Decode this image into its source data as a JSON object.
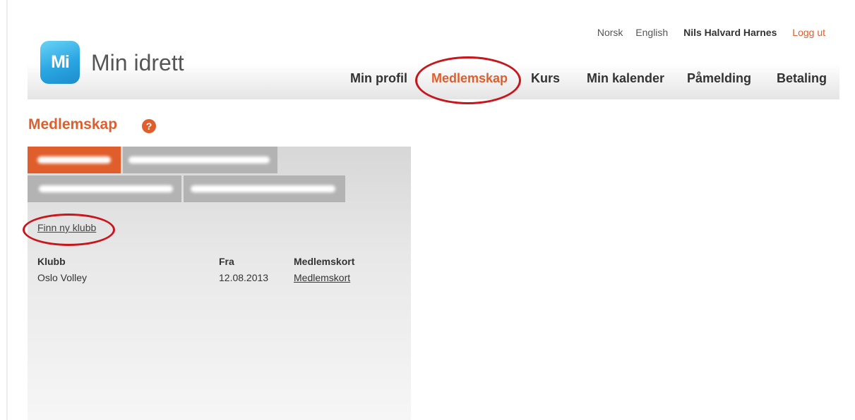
{
  "brand": {
    "logo_mark": "Mi",
    "name": "Min idrett"
  },
  "top_links": {
    "lang_norsk": "Norsk",
    "lang_english": "English",
    "user_name": "Nils Halvard Harnes",
    "logout": "Logg ut"
  },
  "nav": {
    "items": [
      {
        "label": "Min profil"
      },
      {
        "label": "Medlemskap",
        "active": true
      },
      {
        "label": "Kurs"
      },
      {
        "label": "Min kalender"
      },
      {
        "label": "Påmelding"
      },
      {
        "label": "Betaling"
      }
    ]
  },
  "page": {
    "title": "Medlemskap",
    "help_icon": "question-icon",
    "help_symbol": "?"
  },
  "members": {
    "tabs_redacted": 4,
    "active_tab_index": 0
  },
  "actions": {
    "find_club": "Finn ny klubb"
  },
  "table": {
    "columns": [
      "Klubb",
      "Fra",
      "Medlemskort"
    ],
    "rows": [
      {
        "klubb": "Oslo Volley",
        "fra": "12.08.2013",
        "medlemskort": "Medlemskort"
      }
    ]
  },
  "colors": {
    "accent": "#e05d2c",
    "annotation": "#c8161d",
    "logo_blue": "#2aa6e3"
  }
}
